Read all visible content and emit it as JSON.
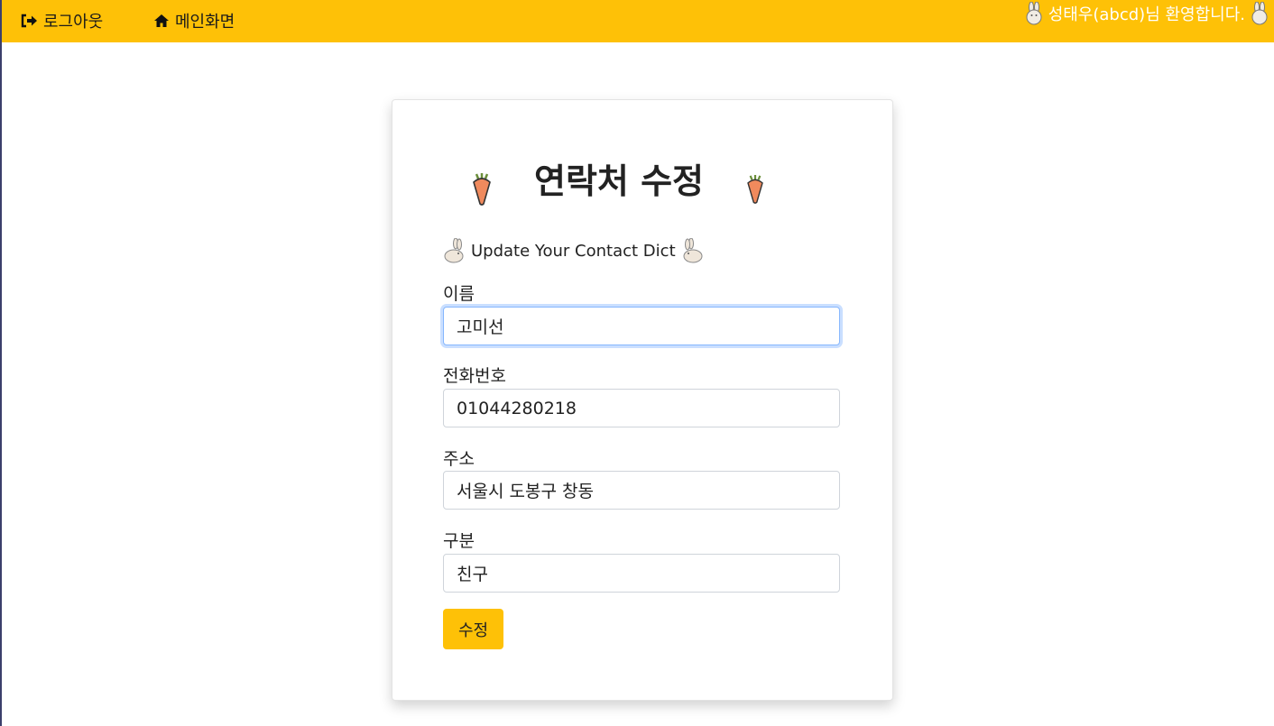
{
  "navbar": {
    "logout_label": "로그아웃",
    "home_label": "메인화면",
    "welcome_text": "성태우(abcd)님 환영합니다.",
    "background": "#fec107"
  },
  "card": {
    "title": "연락처 수정",
    "subtitle": "Update Your Contact Dict"
  },
  "form": {
    "name": {
      "label": "이름",
      "value": "고미선"
    },
    "phone": {
      "label": "전화번호",
      "value": "01044280218"
    },
    "address": {
      "label": "주소",
      "value": "서울시 도봉구 창동"
    },
    "category": {
      "label": "구분",
      "value": "친구"
    },
    "submit_label": "수정"
  },
  "icons": {
    "logout": "sign-out-icon",
    "home": "home-icon",
    "title_decor": "carrot-icon",
    "subtitle_decor": "rabbit-icon",
    "welcome_decor": "rabbit-icon"
  }
}
